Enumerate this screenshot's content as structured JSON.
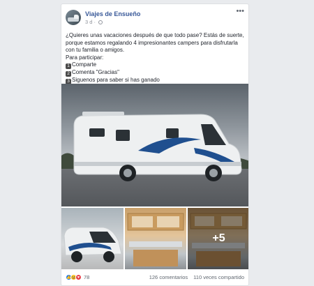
{
  "post": {
    "page_name": "Viajes de Ensueño",
    "time": "3 d",
    "separator": "·",
    "text": [
      "¿Quieres unas vacaciones después de que todo pase? Estás de suerte, porque estamos regalando 4 impresionantes campers para disfrutarla con tu familia o amigos.",
      "Para participar:"
    ],
    "steps": [
      {
        "num": "1",
        "label": "Comparte"
      },
      {
        "num": "2",
        "label": "Comenta \"Gracias\""
      },
      {
        "num": "3",
        "label": "Siguenos para saber si has ganado"
      }
    ],
    "more_photos": "+5",
    "reaction_count": "78",
    "comments": "126 comentarios",
    "shares": "110 veces compartido"
  },
  "icons": {
    "more": "more-options-icon",
    "globe": "globe-icon",
    "like": "like-reaction-icon",
    "haha": "haha-reaction-icon",
    "love": "love-reaction-icon"
  },
  "colors": {
    "link": "#385898",
    "like": "#1877f2",
    "haha": "#f7b125",
    "love": "#e8414b"
  }
}
